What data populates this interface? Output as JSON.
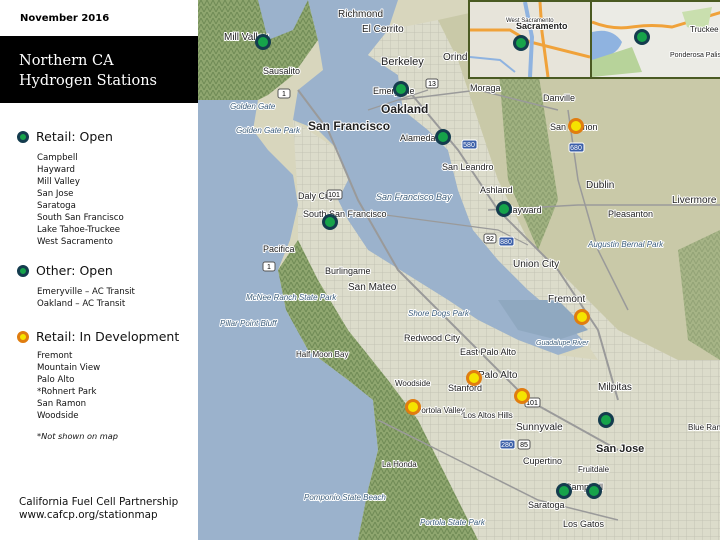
{
  "header": {
    "date": "November 2016",
    "title_line1": "Northern CA",
    "title_line2": "Hydrogen Stations"
  },
  "legend": {
    "retail_open": {
      "label": "Retail: Open",
      "marker_color": "#16a34a",
      "marker_border": "#143c4e",
      "stations": [
        "Campbell",
        "Hayward",
        "Mill Valley",
        "San Jose",
        "Saratoga",
        "South San Francisco",
        "Lake Tahoe-Truckee",
        "West Sacramento"
      ]
    },
    "other_open": {
      "label": "Other: Open",
      "marker_color": "#16a34a",
      "marker_border": "#143c4e",
      "stations": [
        "Emeryville – AC Transit",
        "Oakland – AC Transit"
      ]
    },
    "retail_dev": {
      "label": "Retail: In Development",
      "marker_color": "#f5e400",
      "marker_border": "#e07d10",
      "stations": [
        "Fremont",
        "Mountain View",
        "Palo Alto",
        "*Rohnert Park",
        "San Ramon",
        "Woodside"
      ]
    },
    "note": "*Not shown on map"
  },
  "credit": {
    "org": "California Fuel Cell Partnership",
    "url": "www.cafcp.org/stationmap"
  },
  "map": {
    "place_labels": {
      "richmond": "Richmond",
      "el_cerrito": "El Cerrito",
      "mill_valley": "Mill Valley",
      "sausalito": "Sausalito",
      "berkeley": "Berkeley",
      "orinda": "Orind",
      "emeryville": "Emeryville",
      "oakland": "Oakland",
      "moraga": "Moraga",
      "danville": "Danville",
      "golden_gate": "Golden Gate",
      "golden_gate_park": "Golden Gate Park",
      "san_francisco": "San Francisco",
      "alameda": "Alameda",
      "san_ramon": "San Ramon",
      "san_leandro": "San Leandro",
      "ashland": "Ashland",
      "dublin": "Dublin",
      "livermore": "Livermore",
      "pleasanton": "Pleasanton",
      "daly_city": "Daly City",
      "south_sf": "South San Francisco",
      "sf_bay": "San Francisco Bay",
      "hayward": "Hayward",
      "augustin": "Augustin Bernal Park",
      "pacifica": "Pacifica",
      "burlingame": "Burlingame",
      "san_mateo": "San Mateo",
      "union_city": "Union City",
      "mcnee": "McNee Ranch State Park",
      "pillar_point": "Pillar Point Bluff",
      "shore_dogs": "Shore Dogs Park",
      "fremont": "Fremont",
      "redwood_city": "Redwood City",
      "guadalupe": "Guadalupe River",
      "half_moon": "Half Moon Bay",
      "east_palo_alto": "East Palo Alto",
      "palo_alto": "Palo Alto",
      "woodside": "Woodside",
      "stanford": "Stanford",
      "milpitas": "Milpitas",
      "portola_valley": "Portola Valley",
      "los_altos_hills": "Los Altos Hills",
      "sunnyvale": "Sunnyvale",
      "san_jose": "San Jose",
      "blue_ranch": "Blue Ranch",
      "la_honda": "La Honda",
      "cupertino": "Cupertino",
      "fruitdale": "Fruitdale",
      "pomponio": "Pomponio State Beach",
      "saratoga": "Saratoga",
      "campbell": "Campbell",
      "portola_park": "Portola State Park",
      "los_gatos": "Los Gatos",
      "sacramento": "Sacramento",
      "west_sacramento": "West Sacramento",
      "truckee": "Truckee",
      "ponderosa": "Ponderosa Palisades"
    },
    "road_shields": [
      "1",
      "13",
      "101",
      "580",
      "680",
      "880",
      "92",
      "280",
      "85",
      "680"
    ],
    "markers": [
      {
        "name": "Mill Valley",
        "type": "open"
      },
      {
        "name": "Emeryville",
        "type": "open"
      },
      {
        "name": "Alameda/Oakland",
        "type": "open"
      },
      {
        "name": "South San Francisco",
        "type": "open"
      },
      {
        "name": "Hayward",
        "type": "open"
      },
      {
        "name": "San Jose",
        "type": "open"
      },
      {
        "name": "Saratoga",
        "type": "open"
      },
      {
        "name": "Campbell",
        "type": "open"
      },
      {
        "name": "West Sacramento",
        "type": "open"
      },
      {
        "name": "Lake Tahoe-Truckee",
        "type": "open"
      },
      {
        "name": "San Ramon",
        "type": "dev"
      },
      {
        "name": "Fremont",
        "type": "dev"
      },
      {
        "name": "Palo Alto",
        "type": "dev"
      },
      {
        "name": "Mountain View",
        "type": "dev"
      },
      {
        "name": "Woodside",
        "type": "dev"
      }
    ]
  }
}
